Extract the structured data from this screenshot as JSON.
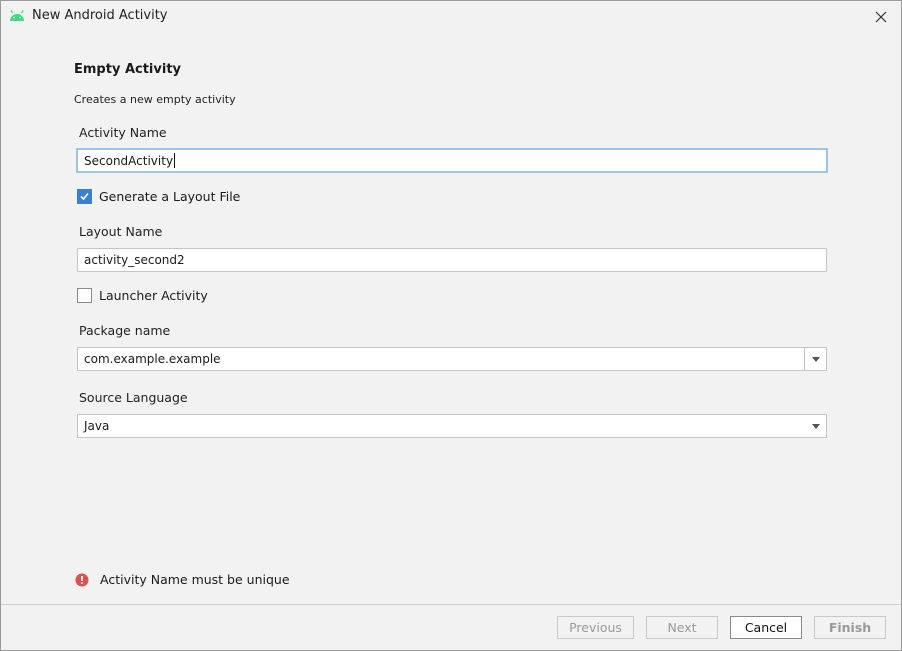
{
  "window": {
    "title": "New Android Activity",
    "app_icon": "android-icon",
    "close_icon": "close-icon"
  },
  "template": {
    "heading": "Empty Activity",
    "description": "Creates a new empty activity"
  },
  "form": {
    "activity_name": {
      "label": "Activity Name",
      "value": "SecondActivity"
    },
    "generate_layout": {
      "label": "Generate a Layout File",
      "checked": true
    },
    "layout_name": {
      "label": "Layout Name",
      "value": "activity_second2"
    },
    "launcher_activity": {
      "label": "Launcher Activity",
      "checked": false
    },
    "package_name": {
      "label": "Package name",
      "value": "com.example.example"
    },
    "source_language": {
      "label": "Source Language",
      "value": "Java"
    }
  },
  "validation": {
    "message": "Activity Name must be unique",
    "icon": "error-icon",
    "color": "#d9534f"
  },
  "buttons": {
    "previous": "Previous",
    "next": "Next",
    "cancel": "Cancel",
    "finish": "Finish"
  },
  "colors": {
    "android_green": "#3ddc84",
    "checkbox_accent": "#3b7fd0",
    "focus_border": "#9cc7ea"
  }
}
